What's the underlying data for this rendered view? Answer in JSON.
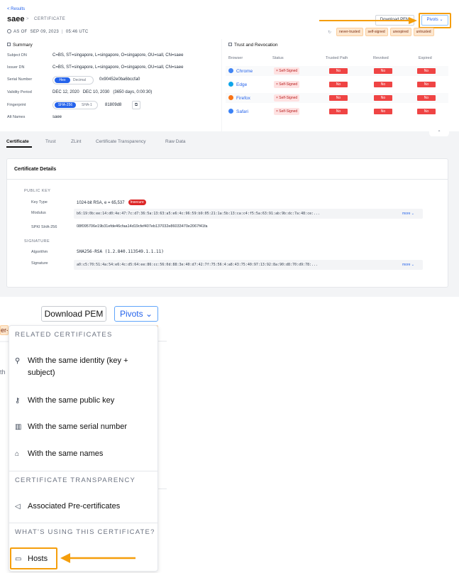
{
  "header": {
    "back_link": "< Results",
    "title": "saee",
    "crumb_sep": ">",
    "crumb": "CERTIFICATE",
    "as_of_label": "AS OF",
    "as_of_date": "SEP 09, 2023",
    "as_of_time": "05:46 UTC",
    "download_label": "Download PEM",
    "pivots_label": "Pivots ⌄",
    "tags": [
      "never-trusted",
      "self-signed",
      "unexpired",
      "untrusted"
    ]
  },
  "summary": {
    "title": "Summary",
    "rows": [
      {
        "label": "Subject DN",
        "value": "C=BS, ST=singapore, L=singapore, O=singapore, OU=sall, CN=saee"
      },
      {
        "label": "Issuer DN",
        "value": "C=BS, ST=singapore, L=singapore, O=singapore, OU=sall, CN=saee"
      },
      {
        "label": "Serial Number",
        "value": "0x90452e0ba6bccfa0"
      },
      {
        "label": "Validity Period",
        "value": "DEC 12, 2020   DEC 10, 2030   (3650 days, 0:00:30)"
      },
      {
        "label": "Fingerprint",
        "value": "81809d8"
      },
      {
        "label": "Alt Names",
        "value": "saee"
      }
    ],
    "serial_toggle": {
      "on": "Hex",
      "off": "Decimal"
    },
    "fp_toggle": {
      "on": "SHA-256",
      "off": "SHA-1"
    }
  },
  "trust": {
    "title": "Trust and Revocation",
    "columns": [
      "Browser",
      "Status",
      "Trusted Path",
      "Revoked",
      "Expired"
    ],
    "rows": [
      {
        "browser": "Chrome",
        "status": "× Self-Signed",
        "trusted": "No",
        "revoked": "No",
        "expired": "No",
        "color": "#4285f4"
      },
      {
        "browser": "Edge",
        "status": "× Self-Signed",
        "trusted": "No",
        "revoked": "No",
        "expired": "No",
        "color": "#0ea5e9"
      },
      {
        "browser": "Firefox",
        "status": "× Self-Signed",
        "trusted": "No",
        "revoked": "No",
        "expired": "No",
        "color": "#f97316"
      },
      {
        "browser": "Safari",
        "status": "× Self-Signed",
        "trusted": "No",
        "revoked": "No",
        "expired": "No",
        "color": "#3b82f6"
      }
    ]
  },
  "tabs": [
    "Certificate",
    "Trust",
    "ZLint",
    "Certificate Transparency",
    "Raw Data"
  ],
  "cert_details": {
    "title": "Certificate Details",
    "public_key_heading": "PUBLIC KEY",
    "key_type_label": "Key Type",
    "key_type_value": "1024-bit RSA, e = 65,537",
    "insecure_badge": "Insecure",
    "modulus_label": "Modulus",
    "modulus_value": "b6:19:0b:ee:14:d0:4e:47:7c:d7:36:5a:13:63:a5:e6:4c:96:59:b9:05:21:1a:5b:13:ca:c4:f5:5a:63:91:ab:9b:dc:7a:48:ce:...",
    "spki_label": "SPKI SHA-256",
    "spki_value": "08f095706e19b31efde46cfaa14d19cfef407eb137032e86033470e2067f41fa",
    "signature_heading": "SIGNATURE",
    "algorithm_label": "Algorithm",
    "algorithm_value": "SHA256-RSA (1.2.840.113549.1.1.11)",
    "signature_label": "Signature",
    "signature_value": "a0:c5:70:51:4a:54:e6:4c:d5:64:ee:86:cc:56:0d:88:3e:40:d7:42:7f:75:56:4:a8:43:75:40:97:13:92:8a:90:d8:70:d9:78:...",
    "more_label": "more ⌄"
  },
  "zoom": {
    "download_label": "Download PEM",
    "pivots_label": "Pivots ⌄",
    "bg_tag": "er-t",
    "bg_text": "th"
  },
  "menu": {
    "related_heading": "RELATED CERTIFICATES",
    "items_related": [
      {
        "icon": "⚲",
        "label": "With the same identity (key + subject)"
      },
      {
        "icon": "⚷",
        "label": "With the same public key"
      },
      {
        "icon": "▥",
        "label": "With the same serial number"
      },
      {
        "icon": "⌂",
        "label": "With the same names"
      }
    ],
    "ct_heading": "CERTIFICATE TRANSPARENCY",
    "ct_item": {
      "icon": "◁",
      "label": "Associated Pre-certificates"
    },
    "using_heading": "WHAT'S USING THIS CERTIFICATE?",
    "hosts_item": {
      "icon": "▭",
      "label": "Hosts"
    }
  },
  "colors": {
    "accent": "#2563eb",
    "annotation": "#f59e0b",
    "danger": "#ef4444"
  }
}
